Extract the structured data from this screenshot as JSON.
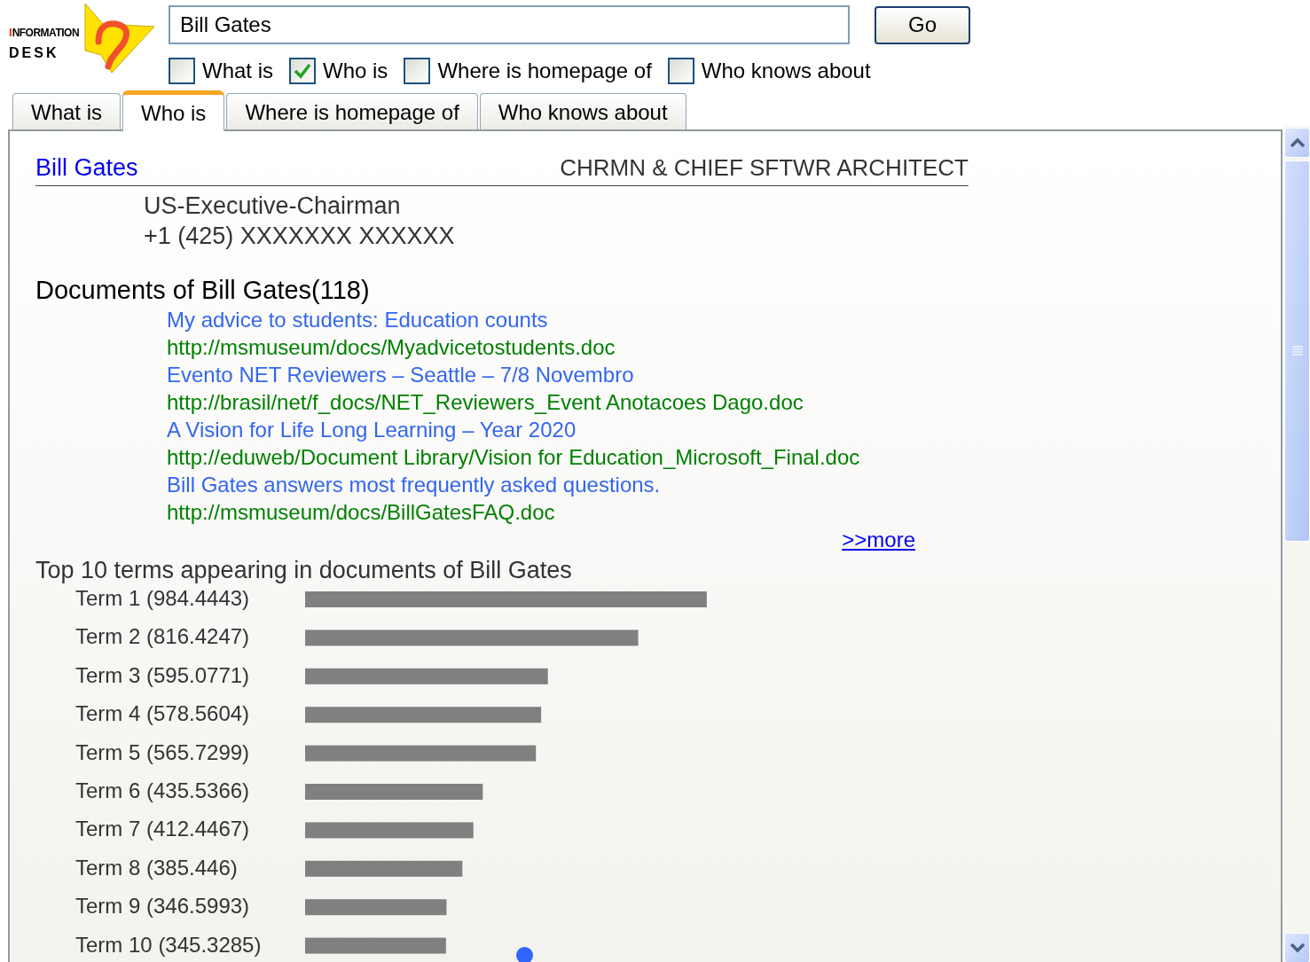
{
  "logo": {
    "line_1": "I",
    "line_2": "NFORMATION",
    "line_3": "DESK"
  },
  "search": {
    "value": "Bill Gates",
    "button": "Go"
  },
  "filters": [
    {
      "label": "What is",
      "checked": false
    },
    {
      "label": "Who is",
      "checked": true
    },
    {
      "label": "Where is homepage of",
      "checked": false
    },
    {
      "label": "Who knows about",
      "checked": false
    }
  ],
  "tabs": [
    {
      "label": "What is",
      "selected": false
    },
    {
      "label": "Who is",
      "selected": true
    },
    {
      "label": "Where is homepage of",
      "selected": false
    },
    {
      "label": "Who knows about",
      "selected": false
    }
  ],
  "person": {
    "name": "Bill Gates",
    "title": "CHRMN & CHIEF SFTWR ARCHITECT",
    "details": [
      "US-Executive-Chairman",
      "+1 (425) XXXXXXX XXXXXX"
    ]
  },
  "documents": {
    "heading": "Documents of Bill Gates(118)",
    "items": [
      {
        "title": "My advice to students: Education counts",
        "url": "http://msmuseum/docs/Myadvicetostudents.doc"
      },
      {
        "title": "Evento NET Reviewers – Seattle – 7/8 Novembro",
        "url": "http://brasil/net/f_docs/NET_Reviewers_Event Anotacoes Dago.doc"
      },
      {
        "title": "A Vision for Life Long Learning – Year 2020",
        "url": "http://eduweb/Document Library/Vision for Education_Microsoft_Final.doc"
      },
      {
        "title": "Bill Gates answers most frequently asked questions.",
        "url": "http://msmuseum/docs/BillGatesFAQ.doc"
      }
    ],
    "more": ">>more"
  },
  "terms": {
    "chart_data": {
      "type": "bar",
      "orientation": "horizontal",
      "title": "Top 10 terms appearing in documents of Bill Gates",
      "categories": [
        "Term 1",
        "Term 2",
        "Term 3",
        "Term 4",
        "Term 5",
        "Term 6",
        "Term 7",
        "Term 8",
        "Term 9",
        "Term 10"
      ],
      "values": [
        984.4443,
        816.4247,
        595.0771,
        578.5604,
        565.7299,
        435.5366,
        412.4467,
        385.446,
        346.5993,
        345.3285
      ],
      "value_labels": [
        "(984.4443)",
        "(816.4247)",
        "(595.0771)",
        "(578.5604)",
        "(565.7299)",
        "(435.5366)",
        "(412.4467)",
        "(385.446)",
        "(346.5993)",
        "(345.3285)"
      ]
    }
  }
}
